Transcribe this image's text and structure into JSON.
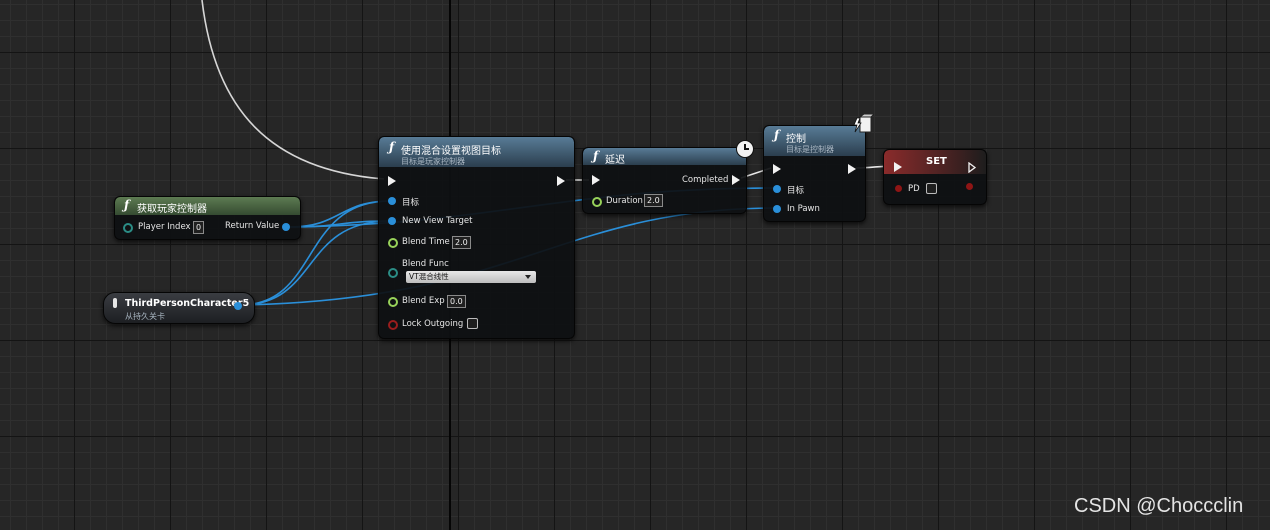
{
  "nodes": {
    "get_controller": {
      "title": "获取玩家控制器",
      "pins": {
        "player_index": "Player Index",
        "player_index_value": "0",
        "return_value": "Return Value"
      }
    },
    "third_person": {
      "title": "ThirdPersonCharacter5",
      "subtitle": "从持久关卡"
    },
    "set_view_target": {
      "title": "使用混合设置视图目标",
      "subtitle": "目标是玩家控制器",
      "pins": {
        "target": "目标",
        "new_view_target": "New View Target",
        "blend_time": "Blend Time",
        "blend_time_value": "2.0",
        "blend_func": "Blend Func",
        "blend_func_value": "VT混合线性",
        "blend_exp": "Blend Exp",
        "blend_exp_value": "0.0",
        "lock_outgoing": "Lock Outgoing"
      }
    },
    "delay": {
      "title": "延迟",
      "pins": {
        "completed": "Completed",
        "duration": "Duration",
        "duration_value": "2.0"
      }
    },
    "possess": {
      "title": "控制",
      "subtitle": "目标是控制器",
      "pins": {
        "target": "目标",
        "in_pawn": "In Pawn"
      }
    },
    "set_var": {
      "title": "SET",
      "pins": {
        "pd": "PD"
      }
    }
  },
  "watermark": "CSDN @Choccclin",
  "icons": {
    "function": "function-icon",
    "clock": "clock-icon",
    "lightning": "lightning-icon",
    "pawn": "pawn-icon",
    "dropdown": "dropdown-arrow-icon"
  },
  "colors": {
    "object_pin": "#2a8fd9",
    "float_pin": "#98d25a",
    "enum_pin": "#2b8d86",
    "bool_pin": "#9a1d1d",
    "pure_header": "#3f5a3a",
    "function_header": "#4f6f88",
    "set_header": "#7a2828"
  }
}
